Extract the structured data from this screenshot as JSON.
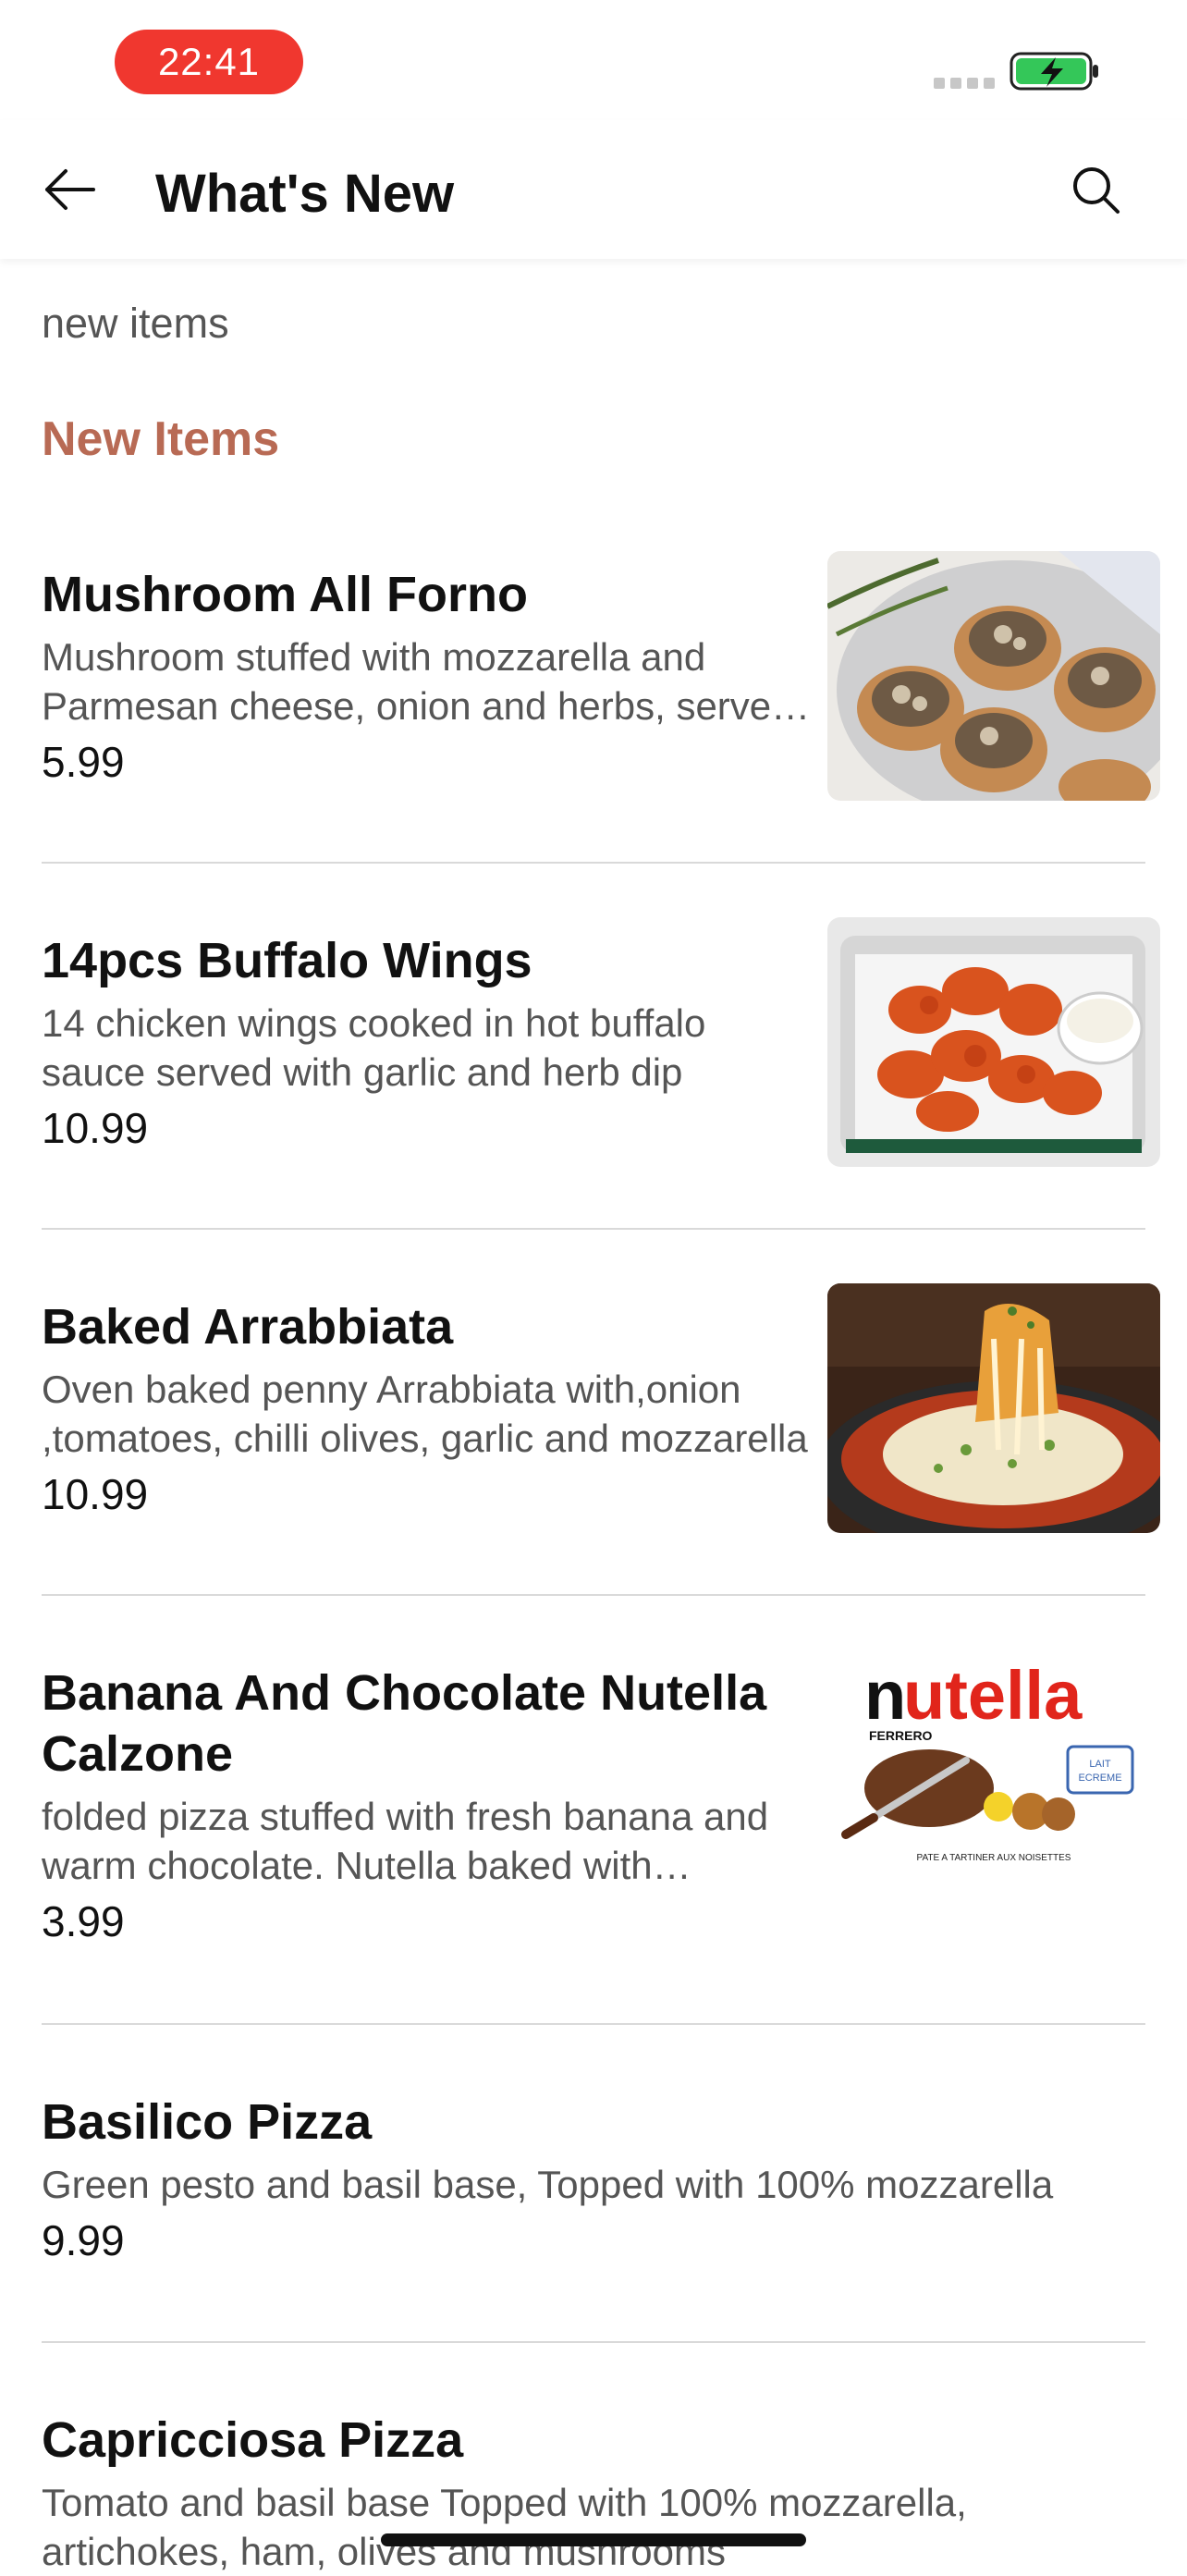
{
  "status_bar": {
    "time": "22:41"
  },
  "header": {
    "title": "What's New"
  },
  "subtitle": "new items",
  "section_title": "New Items",
  "items": [
    {
      "name": "Mushroom All Forno",
      "description": "Mushroom stuffed with mozzarella and Parmesan cheese, onion and herbs, served with salad",
      "price": "5.99",
      "image": "mushroom-dish-photo"
    },
    {
      "name": "14pcs Buffalo Wings",
      "description": "14 chicken wings cooked in hot buffalo sauce served with garlic and herb dip",
      "price": "10.99",
      "image": "buffalo-wings-photo"
    },
    {
      "name": "Baked Arrabbiata",
      "description": "Oven baked penny Arrabbiata with,onion ,tomatoes, chilli olives, garlic and mozzarella",
      "price": "10.99",
      "image": "baked-pasta-photo"
    },
    {
      "name": "Banana And Chocolate Nutella Calzone",
      "description": "folded pizza stuffed with fresh banana and warm chocolate. Nutella baked with marshmallows",
      "price": "3.99",
      "image": "nutella-jar-label",
      "image_text": {
        "brand": "nutella",
        "maker": "FERRERO",
        "tagline": "PATE A TARTINER AUX NOISETTES",
        "badge": "LAIT ECREME"
      }
    },
    {
      "name": "Basilico Pizza",
      "description": "Green pesto and basil base, Topped with 100% mozzarella",
      "price": "9.99"
    },
    {
      "name": "Capricciosa Pizza",
      "description": "Tomato and basil base Topped with 100% mozzarella, artichokes, ham, olives and mushrooms"
    }
  ],
  "colors": {
    "accent": "#b86a54",
    "time_pill": "#f0372f",
    "battery": "#34c759"
  }
}
